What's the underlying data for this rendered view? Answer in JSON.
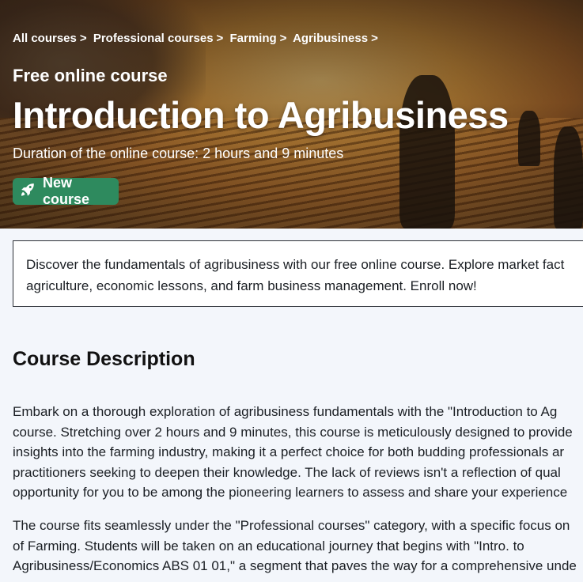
{
  "breadcrumb": [
    {
      "label": "All courses"
    },
    {
      "label": "Professional courses"
    },
    {
      "label": "Farming"
    },
    {
      "label": "Agribusiness"
    }
  ],
  "breadcrumb_separator": ">",
  "hero": {
    "eyebrow": "Free online course",
    "title": "Introduction to Agribusiness",
    "duration": "Duration of the online course: 2 hours and 9 minutes",
    "badge": {
      "label": "New course",
      "icon": "rocket-icon",
      "color": "#2e8a5e"
    }
  },
  "summary": {
    "lines": [
      "Discover the fundamentals of agribusiness with our free online course. Explore market fact",
      "agriculture, economic lessons, and farm business management. Enroll now!"
    ]
  },
  "description": {
    "heading": "Course Description",
    "paragraph1": [
      "Embark on a thorough exploration of agribusiness fundamentals with the \"Introduction to Ag",
      "course. Stretching over 2 hours and 9 minutes, this course is meticulously designed to provide",
      "insights into the farming industry, making it a perfect choice for both budding professionals ar",
      "practitioners seeking to deepen their knowledge. The lack of reviews isn't a reflection of qual",
      "opportunity for you to be among the pioneering learners to assess and share your experience"
    ],
    "paragraph2": [
      "The course fits seamlessly under the \"Professional courses\" category, with a specific focus on",
      "of Farming. Students will be taken on an educational journey that begins with \"Intro. to",
      "Agribusiness/Economics ABS 01 01,\" a segment that paves the way for a comprehensive unde"
    ]
  }
}
